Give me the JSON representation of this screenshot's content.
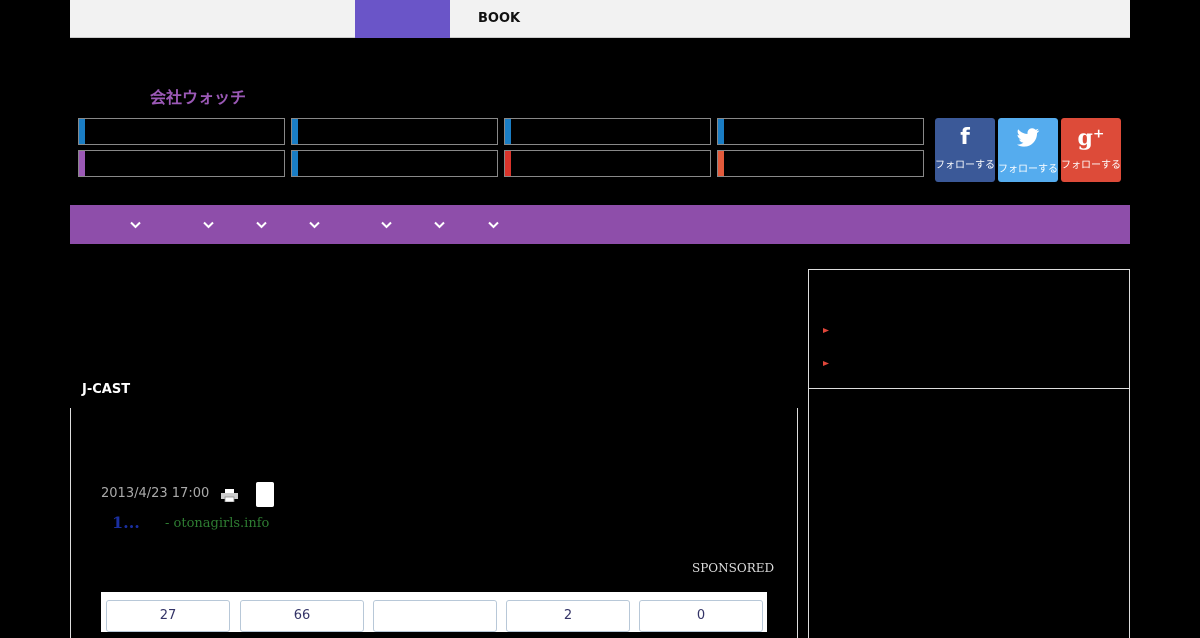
{
  "topbar": {
    "book_label": "BOOK"
  },
  "logo": {
    "text": "会社ウォッチ"
  },
  "category_bars": [
    {
      "accent": "#1a7dc4"
    },
    {
      "accent": "#1a7dc4"
    },
    {
      "accent": "#1a7dc4"
    },
    {
      "accent": "#1a7dc4"
    },
    {
      "accent": "#9b59b6"
    },
    {
      "accent": "#1a7dc4"
    },
    {
      "accent": "#d9342b"
    },
    {
      "accent": "#e25a3b"
    }
  ],
  "social": [
    {
      "name": "facebook",
      "glyph": "f",
      "label": "フォローする",
      "color": "#3b5998"
    },
    {
      "name": "twitter",
      "glyph": "🐦",
      "label": "フォローする",
      "color": "#55acee"
    },
    {
      "name": "googleplus",
      "glyph": "g⁺",
      "label": "フォローする",
      "color": "#dd4b39"
    }
  ],
  "nav": {
    "color": "#8e4eaa"
  },
  "article": {
    "section": "J-CAST",
    "date": "2013/4/23 17:00",
    "headline": "1...",
    "source": "- otonagirls.info",
    "sponsored": "SPONSORED",
    "counts": [
      "27",
      "66",
      "",
      "2",
      "0"
    ]
  },
  "colors": {
    "topbar_active": "#6a55c8",
    "logo": "#9b59b6",
    "headline": "#1a2fa0",
    "source": "#2e7d32"
  }
}
